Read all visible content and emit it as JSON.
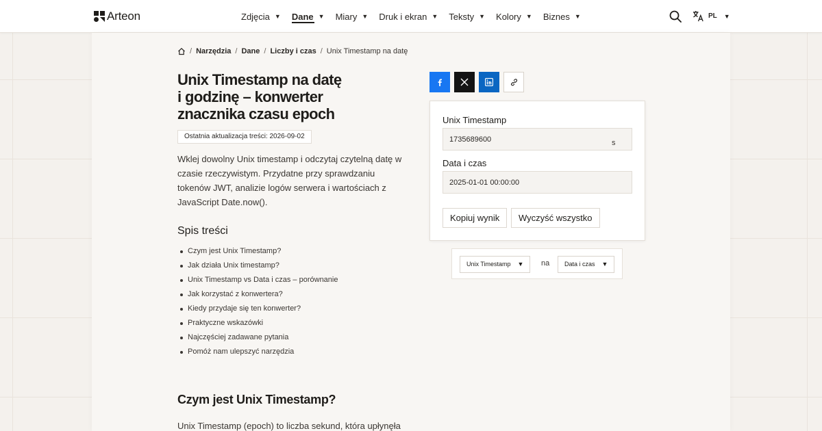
{
  "header": {
    "brand": "Arteon",
    "nav": [
      {
        "label": "Zdjęcia",
        "active": false
      },
      {
        "label": "Dane",
        "active": true
      },
      {
        "label": "Miary",
        "active": false
      },
      {
        "label": "Druk i ekran",
        "active": false
      },
      {
        "label": "Teksty",
        "active": false
      },
      {
        "label": "Kolory",
        "active": false
      },
      {
        "label": "Biznes",
        "active": false
      }
    ],
    "caret": "▼",
    "lang": "PL"
  },
  "breadcrumb": {
    "items": [
      "Narzędzia",
      "Dane",
      "Liczby i czas"
    ],
    "current": "Unix Timestamp na datę",
    "separator": "/"
  },
  "article": {
    "title_line1": "Unix Timestamp na datę",
    "title_line2": "i godzinę – konwerter",
    "title_line3": "znacznika czasu epoch",
    "updated": "Ostatnia aktualizacja treści: 2026-09-02",
    "intro": "Wklej dowolny Unix timestamp i odczytaj czytelną datę w czasie rzeczywistym. Przydatne przy sprawdzaniu tokenów JWT, analizie logów serwera i wartościach z JavaScript Date.now().",
    "toc_title": "Spis treści",
    "toc": [
      "Czym jest Unix Timestamp?",
      "Jak działa Unix timestamp?",
      "Unix Timestamp vs Data i czas – porównanie",
      "Jak korzystać z konwertera?",
      "Kiedy przydaje się ten konwerter?",
      "Praktyczne wskazówki",
      "Najczęściej zadawane pytania",
      "Pomóż nam ulepszyć narzędzia"
    ],
    "section_title": "Czym jest Unix Timestamp?",
    "section_text": "Unix Timestamp (epoch) to liczba sekund, która upłynęła"
  },
  "converter": {
    "timestamp_label": "Unix Timestamp",
    "timestamp_value": "1735689600",
    "timestamp_unit": "s",
    "datetime_label": "Data i czas",
    "datetime_value": "2025-01-01 00:00:00",
    "copy_button": "Kopiuj wynik",
    "clear_button": "Wyczyść wszystko"
  },
  "switcher": {
    "from": "Unix Timestamp",
    "to_word": "na",
    "to": "Data i czas"
  },
  "colors": {
    "facebook": "#1877f2",
    "x": "#141414",
    "linkedin": "#0a66c2"
  },
  "icons": [
    "home-icon",
    "search-icon",
    "translate-icon",
    "facebook-icon",
    "x-icon",
    "linkedin-icon",
    "link-icon"
  ]
}
